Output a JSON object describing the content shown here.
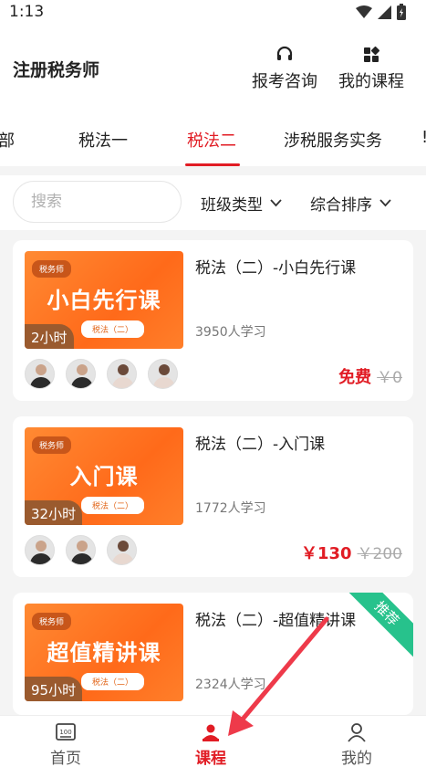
{
  "status_bar": {
    "time": "1:13"
  },
  "header": {
    "title": "注册税务师",
    "actions": [
      {
        "label": "报考咨询",
        "icon": "headset-icon"
      },
      {
        "label": "我的课程",
        "icon": "grid-icon"
      }
    ]
  },
  "tabs": [
    "部",
    "税法一",
    "税法二",
    "涉税服务实务",
    "!"
  ],
  "active_tab": "税法二",
  "filters": {
    "search_placeholder": "搜索",
    "class_type": "班级类型",
    "sort": "综合排序"
  },
  "courses": [
    {
      "thumb_tag": "税务师",
      "thumb_title": "小白先行课",
      "thumb_sub": "税法（二）",
      "hours": "2小时",
      "title": "税法（二）-小白先行课",
      "learners": "3950人学习",
      "price": "免费",
      "original_price": "￥0",
      "ribbon": ""
    },
    {
      "thumb_tag": "税务师",
      "thumb_title": "入门课",
      "thumb_sub": "税法（二）",
      "hours": "32小时",
      "title": "税法（二）-入门课",
      "learners": "1772人学习",
      "price": "￥130",
      "original_price": "￥200",
      "ribbon": ""
    },
    {
      "thumb_tag": "税务师",
      "thumb_title": "超值精讲课",
      "thumb_sub": "税法（二）",
      "hours": "95小时",
      "title": "税法（二）-超值精讲课",
      "learners": "2324人学习",
      "price": "",
      "original_price": "",
      "ribbon": "推荐"
    }
  ],
  "bottom_nav": [
    {
      "label": "首页",
      "icon": "home-icon"
    },
    {
      "label": "课程",
      "icon": "course-icon"
    },
    {
      "label": "我的",
      "icon": "profile-icon"
    }
  ],
  "colors": {
    "accent": "#e11c24",
    "ribbon": "#27c28c",
    "thumb": "#ff7a24"
  }
}
